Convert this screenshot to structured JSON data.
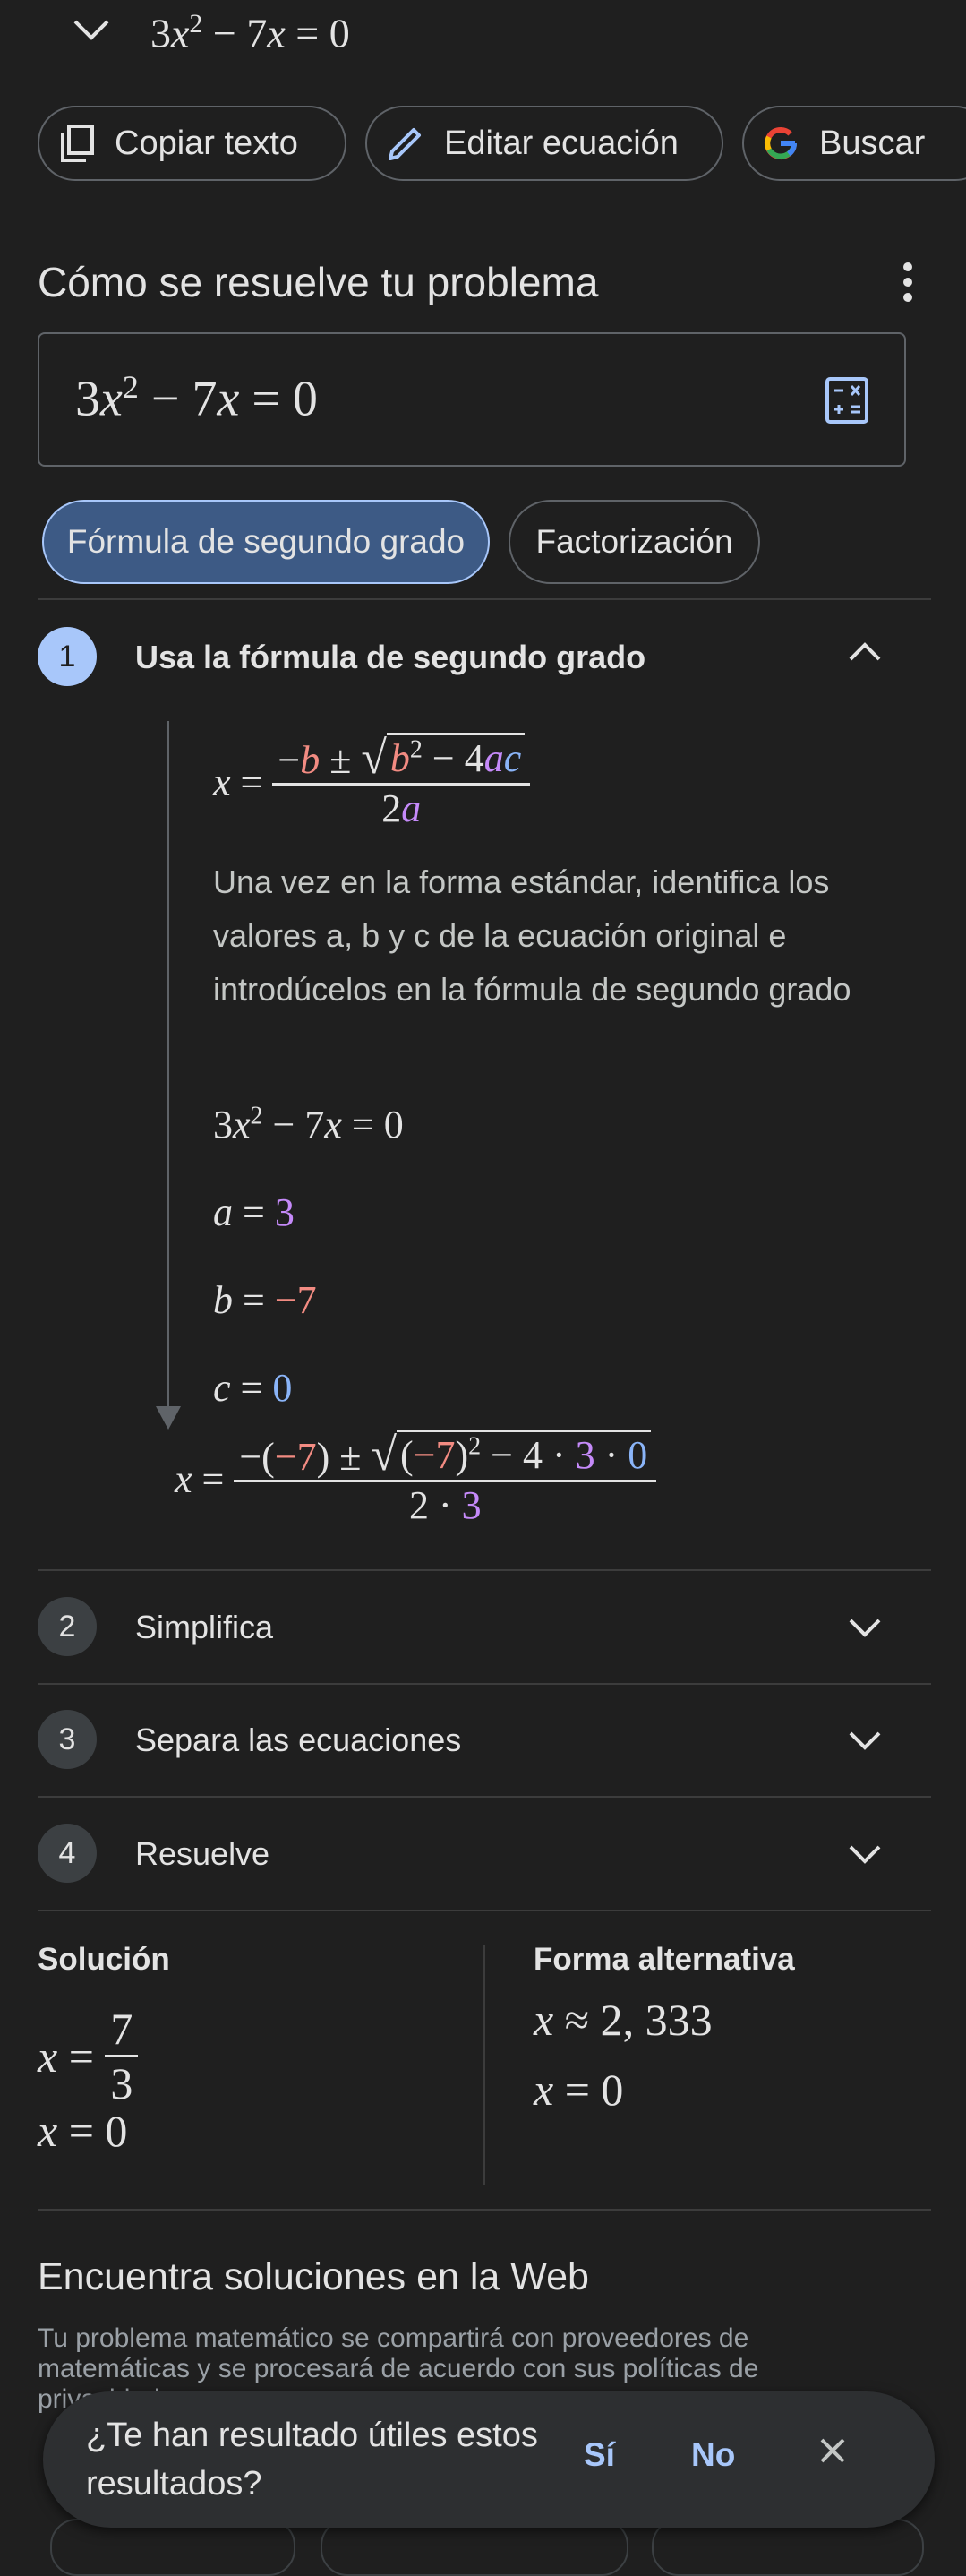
{
  "top": {
    "equation": {
      "c": "3",
      "v": "x",
      "exp": "2",
      "rest_op": " − 7",
      "v2": "x",
      "eq": " = 0"
    },
    "actions": [
      {
        "label": "Copiar texto",
        "icon": "copy-icon"
      },
      {
        "label": "Editar ecuación",
        "icon": "pencil-icon"
      },
      {
        "label": "Buscar",
        "icon": "google-g-icon"
      }
    ]
  },
  "solver": {
    "title": "Cómo se resuelve tu problema",
    "tabs": [
      "Fórmula de segundo grado",
      "Factorización"
    ],
    "steps": [
      {
        "number": "1",
        "label": "Usa la fórmula de segundo grado"
      },
      {
        "number": "2",
        "label": "Simplifica"
      },
      {
        "number": "3",
        "label": "Separa las ecuaciones"
      },
      {
        "number": "4",
        "label": "Resuelve"
      }
    ],
    "step1": {
      "description": "Una vez en la forma estándar, identifica los valores a, b y c de la ecuación original e introdúcelos en la fórmula de segundo grado",
      "a_value": "3",
      "b_value": "−7",
      "c_value": "0"
    }
  },
  "solution": {
    "heading": "Solución",
    "alt_heading": "Forma alternativa",
    "x1_num": "7",
    "x1_den": "3",
    "x2": "0",
    "alt1": "2, 333",
    "alt2": "0"
  },
  "web": {
    "title": "Encuentra soluciones en la Web",
    "description": "Tu problema matemático se compartirá con proveedores de matemáticas y se procesará de acuerdo con sus políticas de privacidad."
  },
  "feedback": {
    "question": "¿Te han resultado útiles estos resultados?",
    "yes": "Sí",
    "no": "No"
  },
  "colors": {
    "accent": "#a8c7fa",
    "active_tab": "#3d5a85",
    "coef_a": "#c58af9",
    "coef_b": "#f28b82",
    "coef_c": "#8ab4f8"
  }
}
